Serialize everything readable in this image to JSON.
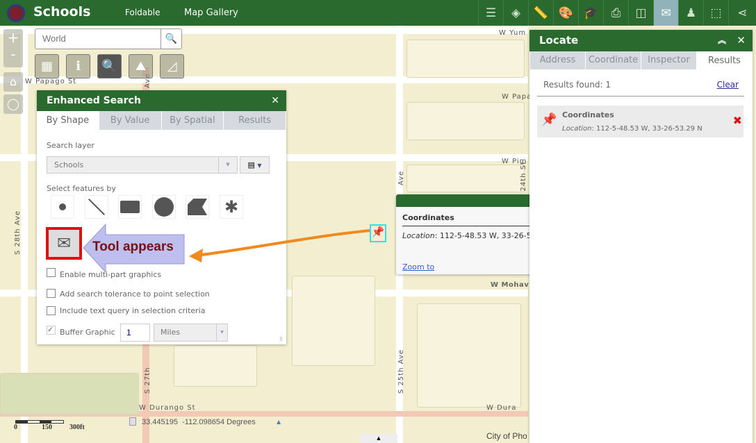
{
  "header": {
    "title": "Schools",
    "links": [
      "Foldable",
      "Map Gallery"
    ],
    "toolbar_icons": [
      "legend-icon",
      "layers-icon",
      "measure-icon",
      "basemap-icon",
      "education-icon",
      "print-icon",
      "swipe-icon",
      "locate-icon",
      "street-view-icon",
      "draw-icon",
      "share-icon"
    ],
    "active_tool": "locate-icon"
  },
  "search": {
    "placeholder": "World"
  },
  "map": {
    "streets": [
      "W Yum",
      "W Papago St",
      "W Papa",
      "W Pim",
      "W Mohav",
      "W Durango St",
      "W Dura",
      "S 24th St",
      "S 25th Ave",
      "S 28th Ave",
      "S 27th",
      "Ave",
      "Ave"
    ],
    "scale": {
      "labels": [
        "0",
        "150",
        "300ft"
      ]
    },
    "coords": "33.445195  -112.098654 Degrees",
    "attribution": "City of Pho"
  },
  "enhanced_search": {
    "title": "Enhanced Search",
    "tabs": [
      "By Shape",
      "By Value",
      "By Spatial",
      "Results"
    ],
    "active_tab": "By Shape",
    "search_layer_label": "Search layer",
    "search_layer_value": "Schools",
    "select_by_label": "Select features by",
    "shapes": [
      "point-icon",
      "line-icon",
      "rectangle-icon",
      "circle-icon",
      "polygon-icon",
      "freehand-icon"
    ],
    "checkboxes": [
      {
        "label": "Enable multi-part graphics",
        "checked": false
      },
      {
        "label": "Add search tolerance to point selection",
        "checked": false
      },
      {
        "label": "Include text query in selection criteria",
        "checked": false
      }
    ],
    "buffer": {
      "label": "Buffer Graphic",
      "checked": true,
      "value": "1",
      "unit": "Miles"
    }
  },
  "annotation": {
    "text": "Tool appears"
  },
  "popup": {
    "title": "Coordinates",
    "location_label": "Location",
    "location_value": ": 112-5-48.53 W, 33-26-53.29 N",
    "zoom_link": "Zoom to"
  },
  "locate": {
    "title": "Locate",
    "tabs": [
      "Address",
      "Coordinate",
      "Inspector",
      "Results"
    ],
    "active_tab": "Results",
    "results_found": "Results found: 1",
    "clear": "Clear",
    "results": [
      {
        "title": "Coordinates",
        "location_label": "Location",
        "location_value": ": 112-5-48.53 W, 33-26-53.29 N"
      }
    ]
  }
}
